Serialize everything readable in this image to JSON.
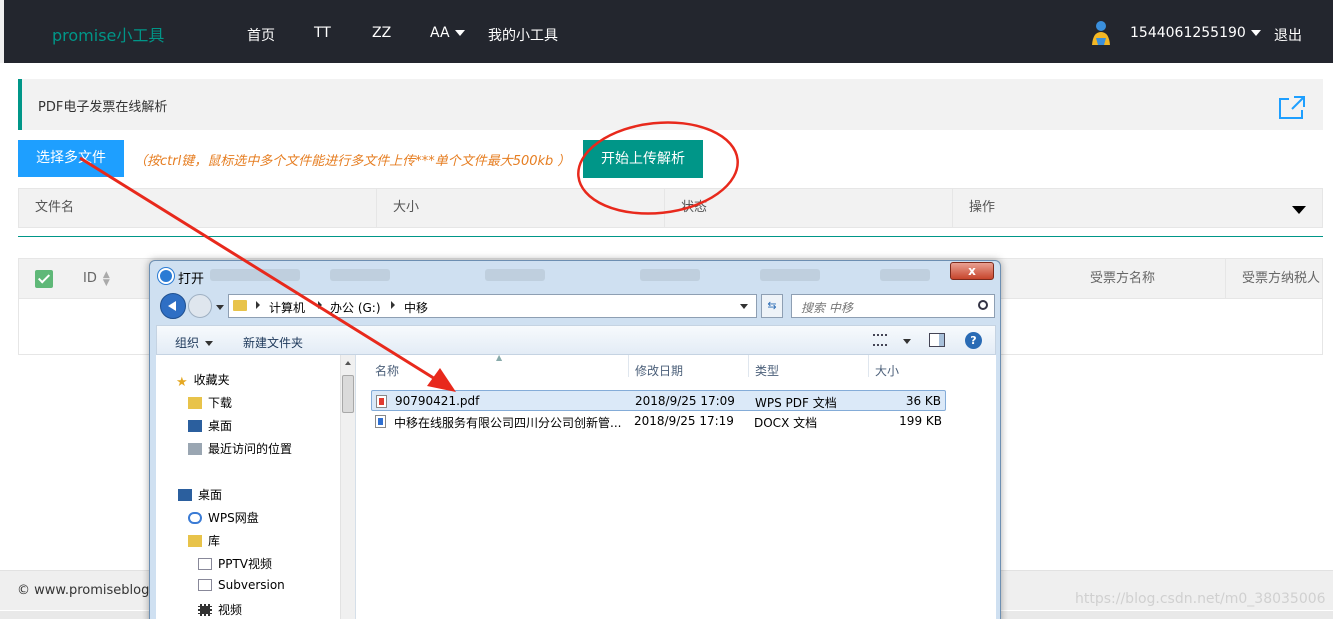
{
  "header": {
    "brand": "promise小工具",
    "nav": [
      "首页",
      "TT",
      "ZZ",
      "AA",
      "我的小工具"
    ],
    "user": "1544061255190",
    "logout": "退出"
  },
  "panel": {
    "title": "PDF电子发票在线解析"
  },
  "upload": {
    "choose_label": "选择多文件",
    "hint": "（按ctrl键，鼠标选中多个文件能进行多文件上传***单个文件最大500kb ）",
    "start_label": "开始上传解析"
  },
  "file_table": {
    "columns": [
      "文件名",
      "大小",
      "状态",
      "操作"
    ]
  },
  "data_table": {
    "columns": [
      "ID",
      "受票方名称",
      "受票方纳税人"
    ]
  },
  "footer": {
    "copyright": "© www.promiseblog.c"
  },
  "watermark": "https://blog.csdn.net/m0_38035006",
  "dialog": {
    "title": "打开",
    "close": "x",
    "breadcrumb": [
      "计算机",
      "办公 (G:)",
      "中移"
    ],
    "search_placeholder": "搜索 中移",
    "toolbar": {
      "organize": "组织",
      "new_folder": "新建文件夹",
      "help": "?"
    },
    "sidebar": {
      "favorites": "收藏夹",
      "favorites_items": [
        "下载",
        "桌面",
        "最近访问的位置"
      ],
      "desktop": "桌面",
      "wps": "WPS网盘",
      "library": "库",
      "library_items": [
        "PPTV视频",
        "Subversion",
        "视频"
      ]
    },
    "columns": [
      "名称",
      "修改日期",
      "类型",
      "大小"
    ],
    "files": [
      {
        "name": "90790421.pdf",
        "date": "2018/9/25 17:09",
        "type": "WPS PDF 文档",
        "size": "36 KB",
        "icon": "pdf-file-icon"
      },
      {
        "name": "中移在线服务有限公司四川分公司创新管...",
        "date": "2018/9/25 17:19",
        "type": "DOCX 文档",
        "size": "199 KB",
        "icon": "docx-file-icon"
      }
    ]
  },
  "colors": {
    "teal": "#009688",
    "blue": "#1e9fff",
    "nav_bg": "#23262e",
    "annotation": "#e8291c"
  }
}
